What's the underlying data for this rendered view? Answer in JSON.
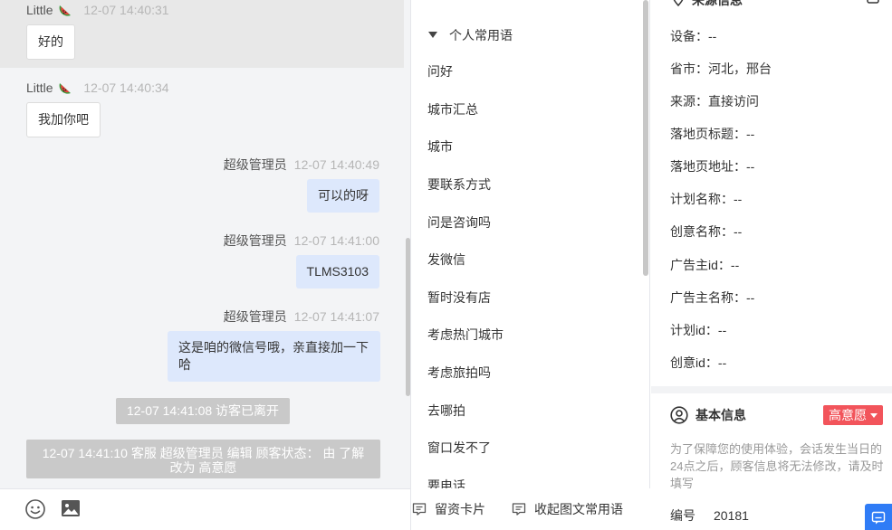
{
  "chat": {
    "messages": [
      {
        "name": "Little",
        "time": "12-07 14:40:31",
        "text": "好的"
      },
      {
        "name": "Little",
        "time": "12-07 14:40:34",
        "text": "我加你吧"
      },
      {
        "name": "超级管理员",
        "time": "12-07 14:40:49",
        "text": "可以的呀"
      },
      {
        "name": "超级管理员",
        "time": "12-07 14:41:00",
        "text": "TLMS3103"
      },
      {
        "name": "超级管理员",
        "time": "12-07 14:41:07",
        "text": "这是咱的微信号哦，亲直接加一下哈"
      }
    ],
    "system": [
      "12-07 14:41:08 访客已离开",
      "12-07 14:41:10 客服 超级管理员 编辑 顾客状态： 由 了解改为 高意愿"
    ],
    "toolbar": {
      "emoji_icon": "emoji-icon",
      "image_icon": "image-icon"
    }
  },
  "phrases": {
    "section_title": "个人常用语",
    "items": [
      "问好",
      "城市汇总",
      "城市",
      "要联系方式",
      "问是咨询吗",
      "发微信",
      "暂时没有店",
      "考虑热门城市",
      "考虑旅拍吗",
      "去哪拍",
      "窗口发不了",
      "要电话"
    ],
    "footer": {
      "lead_card": "留资卡片",
      "collapse": "收起图文常用语"
    }
  },
  "info": {
    "source_title": "来源信息",
    "rows": [
      {
        "label": "设备：",
        "value": "--"
      },
      {
        "label": "省市：",
        "value": "河北，邢台"
      },
      {
        "label": "来源：",
        "value": "直接访问"
      },
      {
        "label": "落地页标题：",
        "value": "--"
      },
      {
        "label": "落地页地址：",
        "value": "--"
      },
      {
        "label": "计划名称：",
        "value": "--"
      },
      {
        "label": "创意名称：",
        "value": "--"
      },
      {
        "label": "广告主id：",
        "value": "--"
      },
      {
        "label": "广告主名称：",
        "value": "--"
      },
      {
        "label": "计划id：",
        "value": "--"
      },
      {
        "label": "创意id：",
        "value": "--"
      }
    ],
    "basic_title": "基本信息",
    "intent_label": "高意愿",
    "notice": "为了保障您的使用体验，会话发生当日的24点之后，顾客信息将无法修改，请及时填写",
    "id_label": "编号",
    "id_value": "20181"
  },
  "colors": {
    "accent": "#2f7cf6",
    "intent_badge": "#f2545b",
    "agent_bubble": "#dde8fc",
    "system_msg": "#c9c9c9"
  }
}
